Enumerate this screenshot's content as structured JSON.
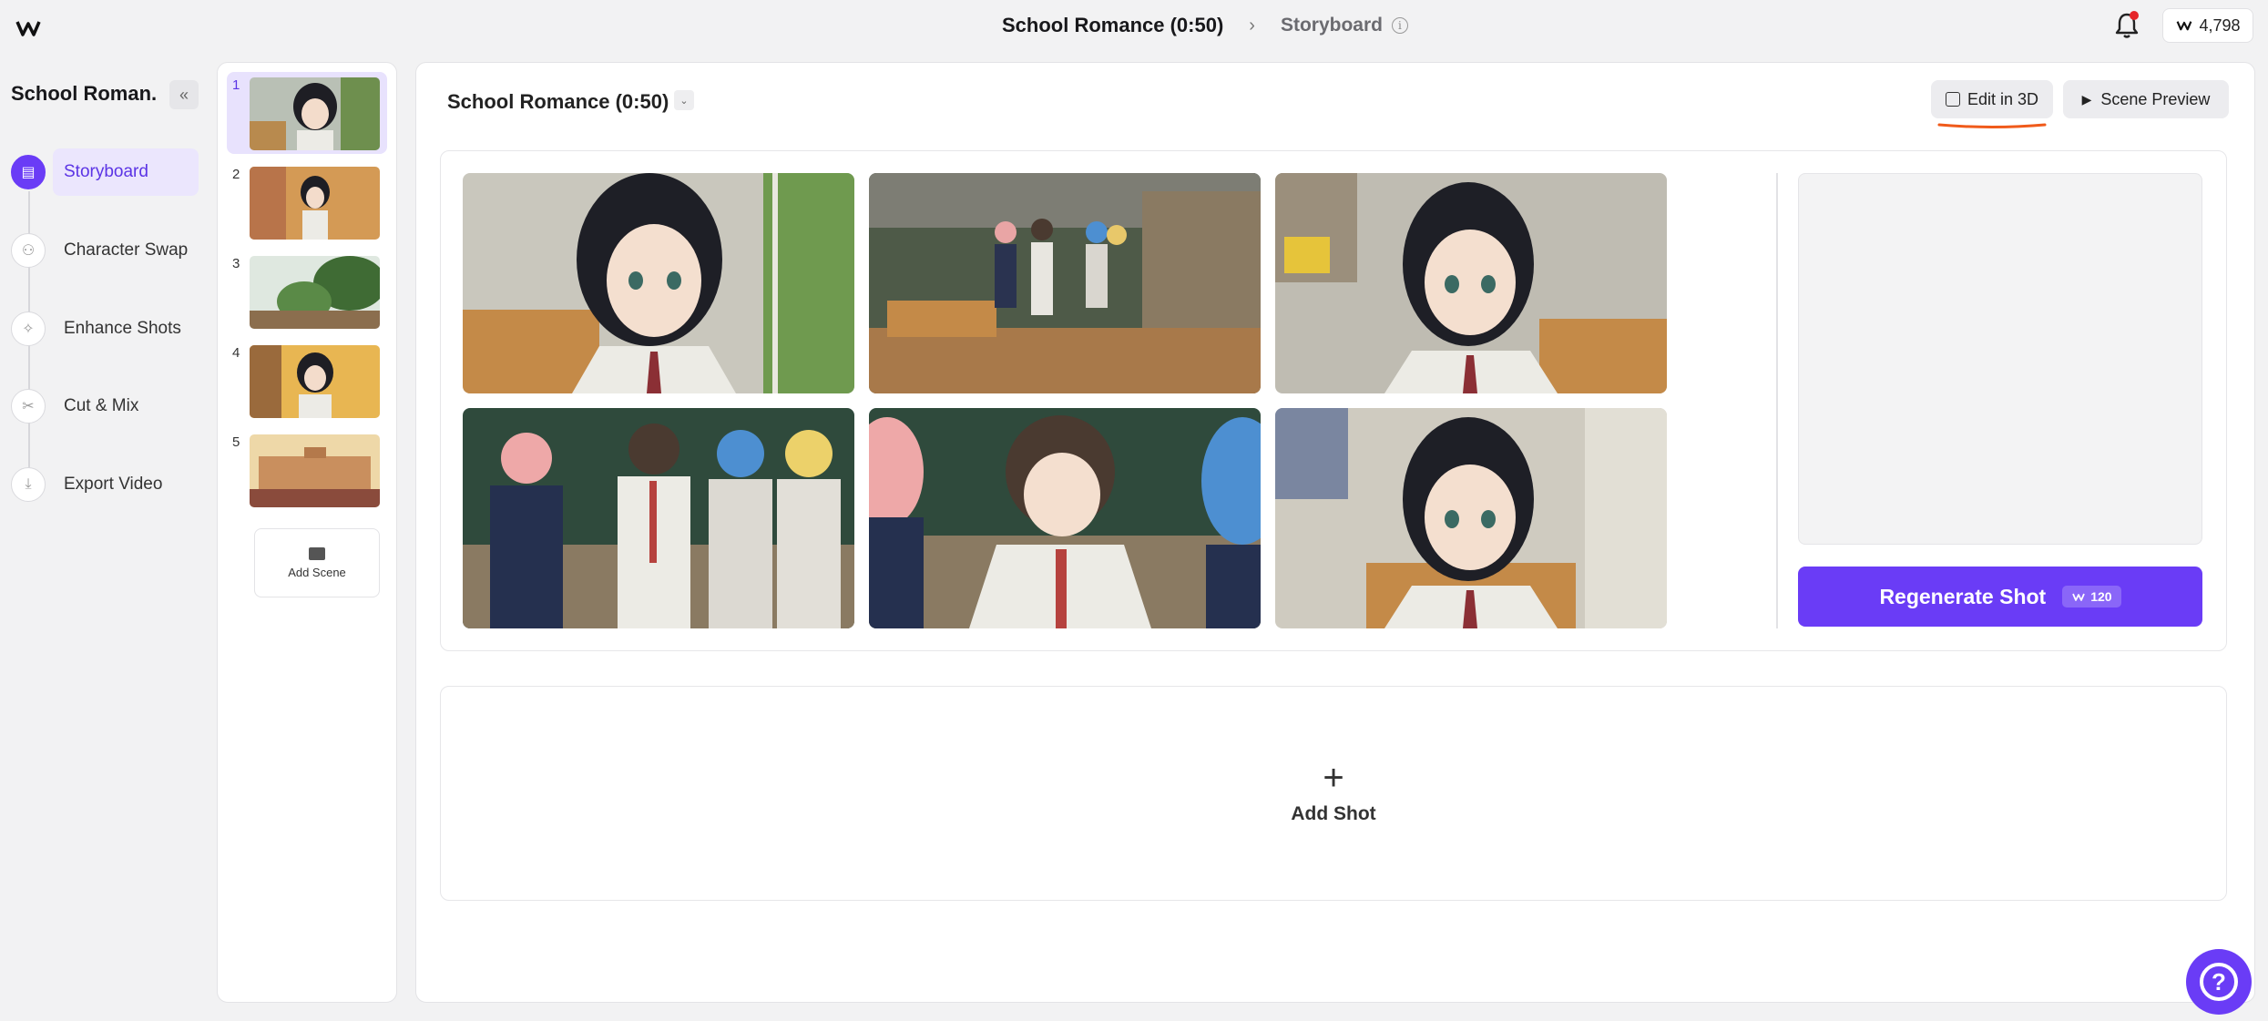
{
  "header": {
    "title": "School Romance (0:50)",
    "breadcrumb": "Storyboard",
    "credits": "4,798"
  },
  "sidebar": {
    "project_name": "School Roman...",
    "items": [
      {
        "label": "Storyboard",
        "icon": "storyboard-icon",
        "active": true
      },
      {
        "label": "Character Swap",
        "icon": "people-icon"
      },
      {
        "label": "Enhance Shots",
        "icon": "sparkle-icon"
      },
      {
        "label": "Cut & Mix",
        "icon": "cut-mix-icon"
      },
      {
        "label": "Export Video",
        "icon": "download-icon"
      }
    ]
  },
  "scenes": {
    "items": [
      {
        "num": "1",
        "selected": true
      },
      {
        "num": "2"
      },
      {
        "num": "3"
      },
      {
        "num": "4"
      },
      {
        "num": "5"
      }
    ],
    "add_label": "Add Scene"
  },
  "main": {
    "scene_title": "School Romance (0:50)",
    "edit3d_label": "Edit in 3D",
    "preview_label": "Scene Preview",
    "regen_label": "Regenerate Shot",
    "regen_cost": "120",
    "add_shot_label": "Add Shot"
  },
  "colors": {
    "accent": "#6a3cf6",
    "accent_light": "#e8e2fd",
    "highlight_underline": "#f05a1a",
    "notification": "#e5262a"
  }
}
